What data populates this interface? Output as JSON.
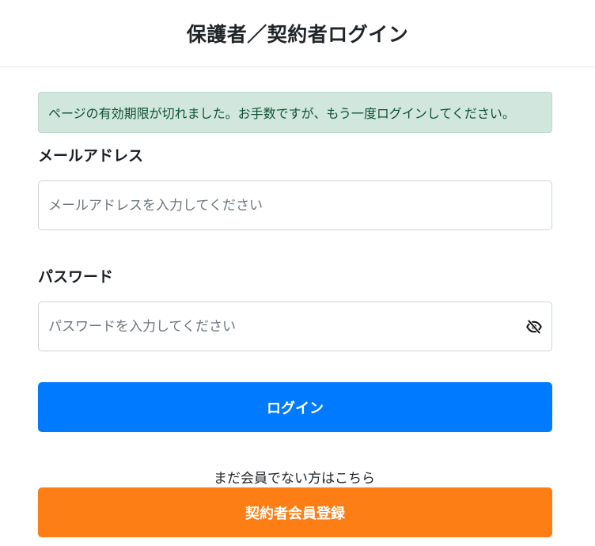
{
  "header": {
    "title": "保護者／契約者ログイン"
  },
  "alert": {
    "message": "ページの有効期限が切れました。お手数ですが、もう一度ログインしてください。"
  },
  "form": {
    "email": {
      "label": "メールアドレス",
      "value": "",
      "placeholder": "メールアドレスを入力してください"
    },
    "password": {
      "label": "パスワード",
      "value": "",
      "placeholder": "パスワードを入力してください",
      "toggle_icon": "eye-slash-icon"
    },
    "login_label": "ログイン"
  },
  "register": {
    "prompt": "まだ会員でない方はこちら",
    "button_label": "契約者会員登録"
  },
  "colors": {
    "primary": "#007bff",
    "register": "#fd7e14",
    "alert_bg": "#d1e7dd",
    "alert_text": "#0f5132"
  }
}
